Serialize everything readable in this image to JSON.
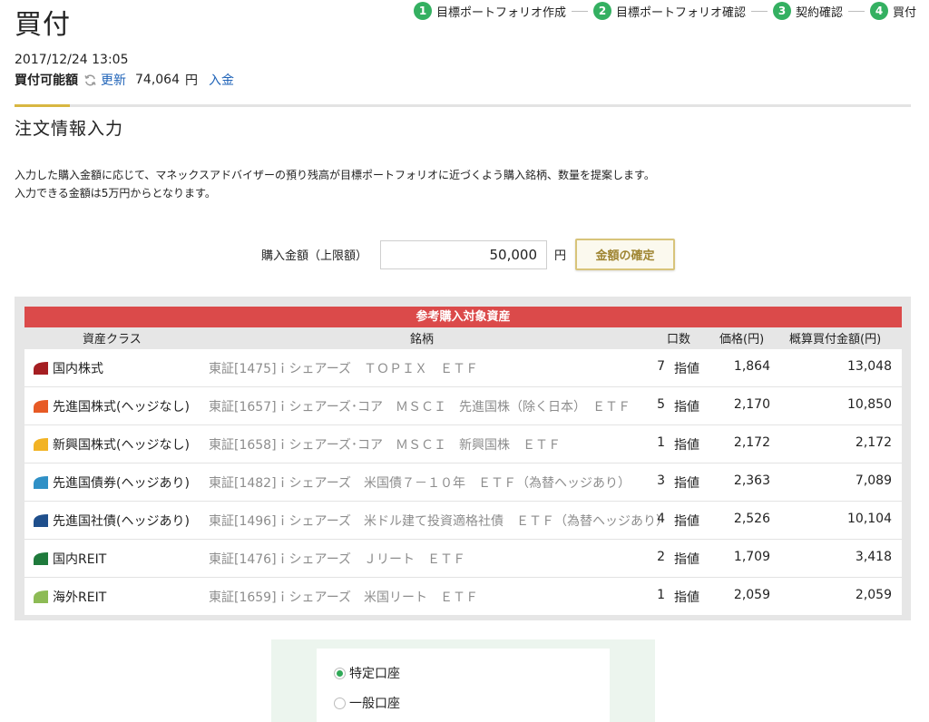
{
  "page_title": "買付",
  "steps": [
    {
      "num": "1",
      "label": "目標ポートフォリオ作成"
    },
    {
      "num": "2",
      "label": "目標ポートフォリオ確認"
    },
    {
      "num": "3",
      "label": "契約確認"
    },
    {
      "num": "4",
      "label": "買付"
    }
  ],
  "datetime": "2017/12/24 13:05",
  "balance": {
    "label": "買付可能額",
    "refresh_label": "更新",
    "amount": "74,064",
    "unit": "円",
    "deposit_label": "入金"
  },
  "section_title": "注文情報入力",
  "description": [
    "入力した購入金額に応じて、マネックスアドバイザーの預り残高が目標ポートフォリオに近づくよう購入銘柄、数量を提案します。",
    "入力できる金額は5万円からとなります。"
  ],
  "order": {
    "label": "購入金額（上限額）",
    "value": "50,000",
    "unit": "円",
    "confirm_label": "金額の確定"
  },
  "table": {
    "title": "参考購入対象資産",
    "headers": {
      "asset_class": "資産クラス",
      "fund": "銘柄",
      "qty": "口数",
      "price": "価格(円)",
      "amount": "概算買付金額(円)"
    },
    "rows": [
      {
        "color": "#a51e22",
        "asset_class": "国内株式",
        "fund": "東証[1475]ｉシェアーズ　ＴＯＰＩＸ　ＥＴＦ",
        "qty": "7",
        "order_type": "指値",
        "price": "1,864",
        "amount": "13,048"
      },
      {
        "color": "#e75a25",
        "asset_class": "先進国株式(ヘッジなし)",
        "fund": "東証[1657]ｉシェアーズ･コア　ＭＳＣＩ　先進国株（除く日本）　ＥＴＦ",
        "qty": "5",
        "order_type": "指値",
        "price": "2,170",
        "amount": "10,850"
      },
      {
        "color": "#f2b324",
        "asset_class": "新興国株式(ヘッジなし)",
        "fund": "東証[1658]ｉシェアーズ･コア　ＭＳＣＩ　新興国株　ＥＴＦ",
        "qty": "1",
        "order_type": "指値",
        "price": "2,172",
        "amount": "2,172"
      },
      {
        "color": "#2f90c6",
        "asset_class": "先進国債券(ヘッジあり)",
        "fund": "東証[1482]ｉシェアーズ　米国債７－１０年　ＥＴＦ（為替ヘッジあり）",
        "qty": "3",
        "order_type": "指値",
        "price": "2,363",
        "amount": "7,089"
      },
      {
        "color": "#1f4f8c",
        "asset_class": "先進国社債(ヘッジあり)",
        "fund": "東証[1496]ｉシェアーズ　米ドル建て投資適格社債　ＥＴＦ（為替ヘッジあり）",
        "qty": "4",
        "order_type": "指値",
        "price": "2,526",
        "amount": "10,104"
      },
      {
        "color": "#1f7a3c",
        "asset_class": "国内REIT",
        "fund": "東証[1476]ｉシェアーズ　Ｊリート　ＥＴＦ",
        "qty": "2",
        "order_type": "指値",
        "price": "1,709",
        "amount": "3,418"
      },
      {
        "color": "#8dbb55",
        "asset_class": "海外REIT",
        "fund": "東証[1659]ｉシェアーズ　米国リート　ＥＴＦ",
        "qty": "1",
        "order_type": "指値",
        "price": "2,059",
        "amount": "2,059"
      }
    ]
  },
  "account": {
    "options": [
      {
        "label": "特定口座",
        "selected": true
      },
      {
        "label": "一般口座",
        "selected": false
      }
    ]
  },
  "colors": {
    "accent_green": "#34b061",
    "header_red": "#db4a4a",
    "link_blue": "#1f63b8",
    "gold": "#d8b741"
  }
}
